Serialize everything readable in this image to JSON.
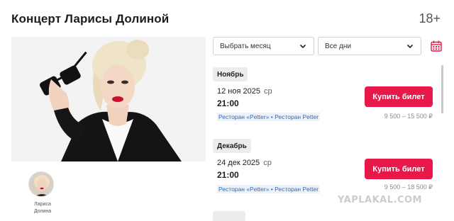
{
  "header": {
    "title": "Концерт Ларисы Долиной",
    "age_rating": "18+"
  },
  "artist": {
    "name": "Лариса Долина"
  },
  "filters": {
    "month_label": "Выбрать месяц",
    "days_label": "Все дни",
    "calendar_icon": "calendar-icon"
  },
  "events": [
    {
      "month": "Ноябрь",
      "date": "12 ноя 2025",
      "weekday": "ср",
      "time": "21:00",
      "venue": "Ресторан «Petter» • Ресторан Petter",
      "buy_label": "Купить билет",
      "price": "9 500 – 15 500 ₽"
    },
    {
      "month": "Декабрь",
      "date": "24 дек 2025",
      "weekday": "ср",
      "time": "21:00",
      "venue": "Ресторан «Petter» • Ресторан Petter",
      "buy_label": "Купить билет",
      "price": "9 500 – 18 500 ₽"
    }
  ],
  "watermark": "YAPLAKAL.COM",
  "colors": {
    "accent": "#e8194a",
    "venue_link": "#2a6db0"
  }
}
